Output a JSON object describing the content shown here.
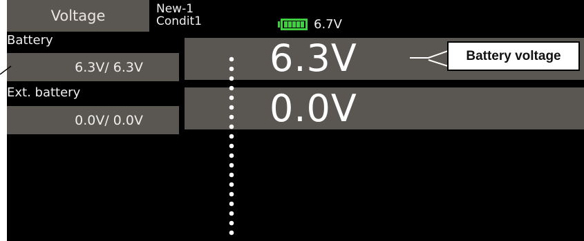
{
  "header": {
    "screen_title": "Voltage",
    "model_name": "New-1",
    "condition_name": "Condit1",
    "battery_icon": "battery-icon",
    "battery_color": "#3fd13f",
    "battery_voltage": "6.7V"
  },
  "battery": {
    "label": "Battery",
    "range_text": "6.3V/ 6.3V",
    "value": "6.3V"
  },
  "ext_battery": {
    "label": "Ext. battery",
    "range_text": "0.0V/ 0.0V",
    "value": "0.0V"
  },
  "callouts": {
    "battery_voltage": "Battery voltage"
  }
}
